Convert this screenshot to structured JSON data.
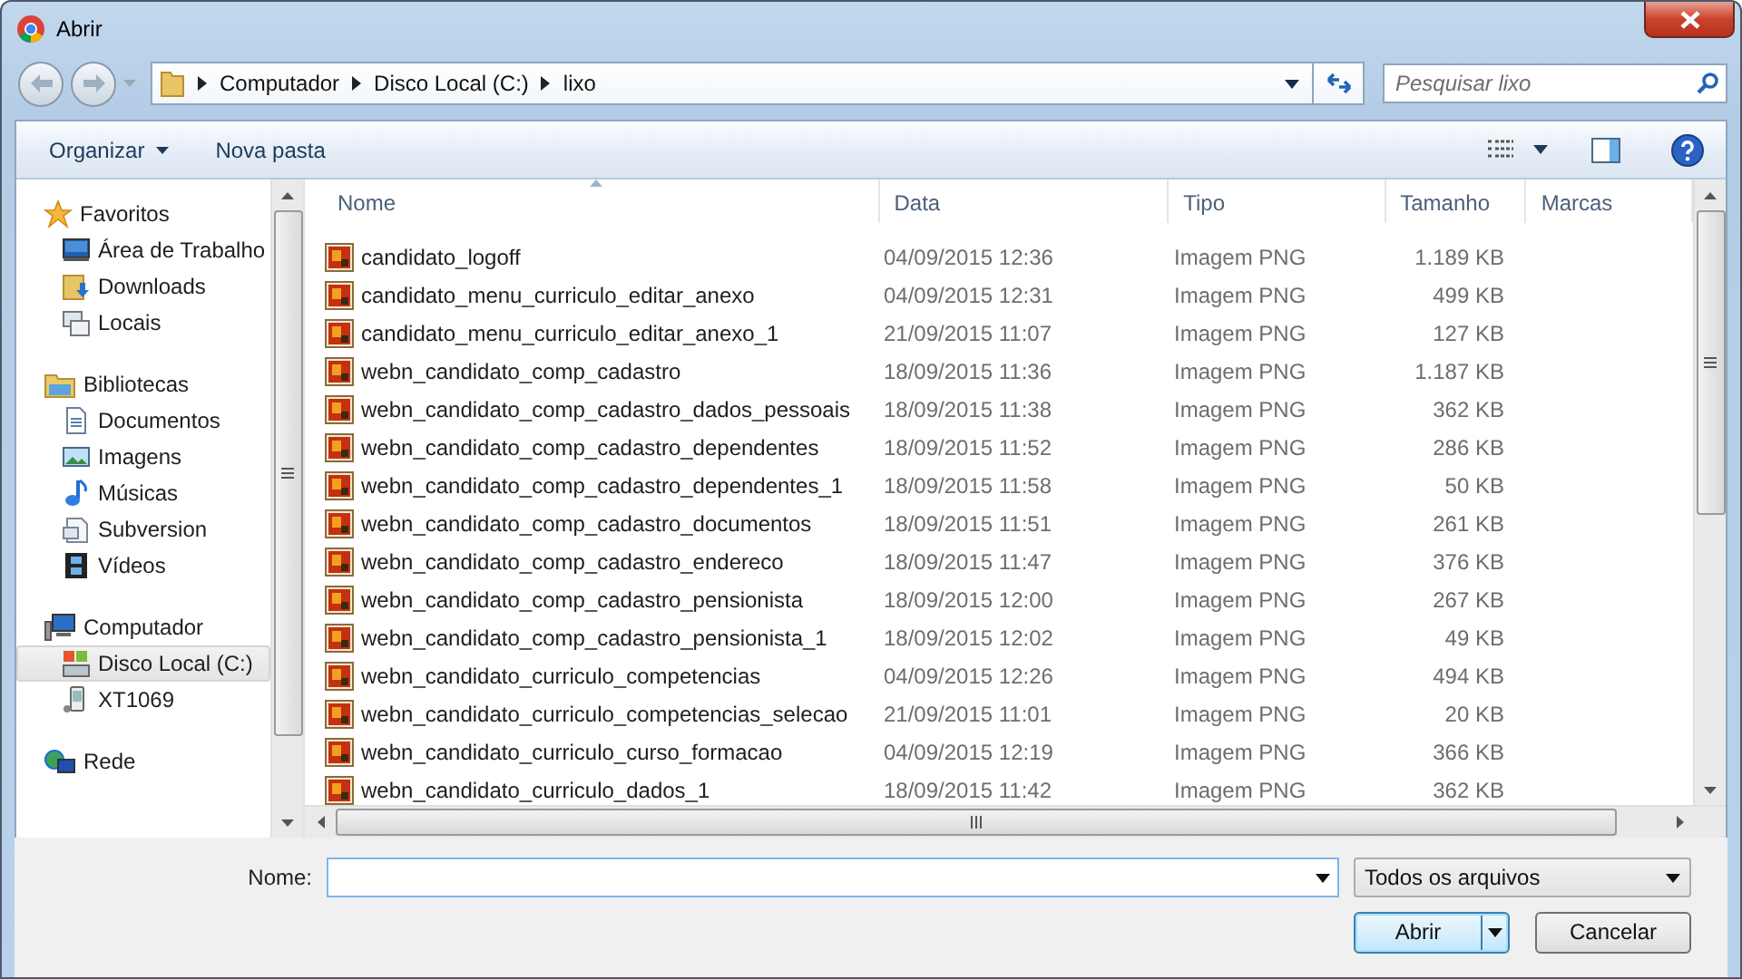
{
  "window": {
    "title": "Abrir"
  },
  "address": {
    "path": [
      "Computador",
      "Disco Local (C:)",
      "lixo"
    ]
  },
  "search": {
    "placeholder": "Pesquisar lixo"
  },
  "toolbar": {
    "organize": "Organizar",
    "new_folder": "Nova pasta"
  },
  "sidebar": {
    "items": [
      {
        "label": "Favoritos",
        "selected": false,
        "children": [
          {
            "label": "Área de Trabalho",
            "selected": false
          },
          {
            "label": "Downloads",
            "selected": false
          },
          {
            "label": "Locais",
            "selected": false
          }
        ]
      },
      {
        "label": "Bibliotecas",
        "selected": false,
        "children": [
          {
            "label": "Documentos",
            "selected": false
          },
          {
            "label": "Imagens",
            "selected": false
          },
          {
            "label": "Músicas",
            "selected": false
          },
          {
            "label": "Subversion",
            "selected": false
          },
          {
            "label": "Vídeos",
            "selected": false
          }
        ]
      },
      {
        "label": "Computador",
        "selected": false,
        "children": [
          {
            "label": "Disco Local (C:)",
            "selected": true
          },
          {
            "label": "XT1069",
            "selected": false
          }
        ]
      },
      {
        "label": "Rede",
        "selected": false
      }
    ]
  },
  "table": {
    "columns": [
      {
        "label": "Nome",
        "sorted": true
      },
      {
        "label": "Data",
        "sorted": false
      },
      {
        "label": "Tipo",
        "sorted": false
      },
      {
        "label": "Tamanho",
        "sorted": false
      },
      {
        "label": "Marcas",
        "sorted": false
      }
    ],
    "rows": [
      {
        "name": "candidato_logoff",
        "date": "04/09/2015 12:36",
        "type": "Imagem PNG",
        "size": "1.189 KB",
        "selected": false
      },
      {
        "name": "candidato_menu_curriculo_editar_anexo",
        "date": "04/09/2015 12:31",
        "type": "Imagem PNG",
        "size": "499 KB",
        "selected": false
      },
      {
        "name": "candidato_menu_curriculo_editar_anexo_1",
        "date": "21/09/2015 11:07",
        "type": "Imagem PNG",
        "size": "127 KB",
        "selected": false
      },
      {
        "name": "webn_candidato_comp_cadastro",
        "date": "18/09/2015 11:36",
        "type": "Imagem PNG",
        "size": "1.187 KB",
        "selected": false
      },
      {
        "name": "webn_candidato_comp_cadastro_dados_pessoais",
        "date": "18/09/2015 11:38",
        "type": "Imagem PNG",
        "size": "362 KB",
        "selected": false
      },
      {
        "name": "webn_candidato_comp_cadastro_dependentes",
        "date": "18/09/2015 11:52",
        "type": "Imagem PNG",
        "size": "286 KB",
        "selected": false
      },
      {
        "name": "webn_candidato_comp_cadastro_dependentes_1",
        "date": "18/09/2015 11:58",
        "type": "Imagem PNG",
        "size": "50 KB",
        "selected": false
      },
      {
        "name": "webn_candidato_comp_cadastro_documentos",
        "date": "18/09/2015 11:51",
        "type": "Imagem PNG",
        "size": "261 KB",
        "selected": false
      },
      {
        "name": "webn_candidato_comp_cadastro_endereco",
        "date": "18/09/2015 11:47",
        "type": "Imagem PNG",
        "size": "376 KB",
        "selected": false
      },
      {
        "name": "webn_candidato_comp_cadastro_pensionista",
        "date": "18/09/2015 12:00",
        "type": "Imagem PNG",
        "size": "267 KB",
        "selected": false
      },
      {
        "name": "webn_candidato_comp_cadastro_pensionista_1",
        "date": "18/09/2015 12:02",
        "type": "Imagem PNG",
        "size": "49 KB",
        "selected": false
      },
      {
        "name": "webn_candidato_curriculo_competencias",
        "date": "04/09/2015 12:26",
        "type": "Imagem PNG",
        "size": "494 KB",
        "selected": false
      },
      {
        "name": "webn_candidato_curriculo_competencias_selecao",
        "date": "21/09/2015 11:01",
        "type": "Imagem PNG",
        "size": "20 KB",
        "selected": false
      },
      {
        "name": "webn_candidato_curriculo_curso_formacao",
        "date": "04/09/2015 12:19",
        "type": "Imagem PNG",
        "size": "366 KB",
        "selected": false
      },
      {
        "name": "webn_candidato_curriculo_dados_1",
        "date": "18/09/2015 11:42",
        "type": "Imagem PNG",
        "size": "362 KB",
        "selected": false
      }
    ]
  },
  "footer": {
    "name_label": "Nome:",
    "file_type": "Todos os arquivos",
    "buttons": [
      {
        "label": "Abrir",
        "kind": "split",
        "default": true
      },
      {
        "label": "Cancelar",
        "kind": "plain",
        "default": false
      }
    ]
  }
}
